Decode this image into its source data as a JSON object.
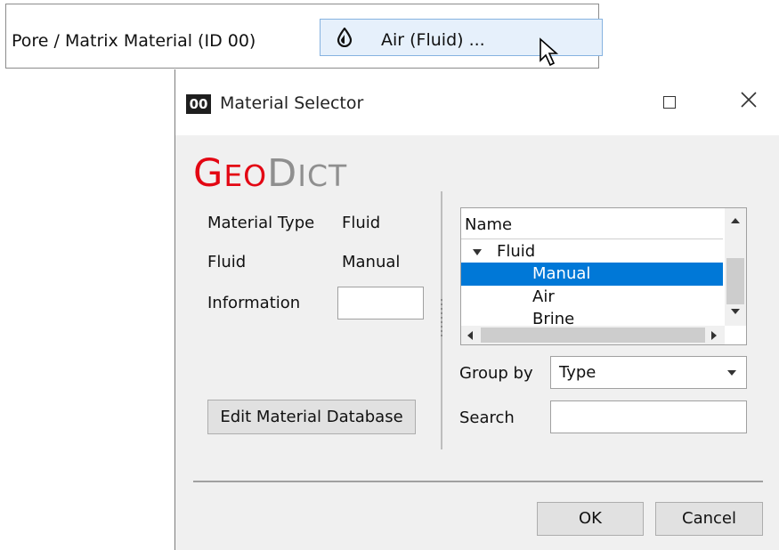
{
  "property": {
    "label": "Pore / Matrix Material (ID 00)",
    "value": "Air (Fluid) ..."
  },
  "window": {
    "icon_text": "00",
    "title": "Material Selector"
  },
  "logo": {
    "geo_big": "G",
    "geo_small": "EO",
    "dict_big": "D",
    "dict_small": "ICT"
  },
  "details": {
    "material_type_label": "Material Type",
    "material_type_value": "Fluid",
    "fluid_label": "Fluid",
    "fluid_value": "Manual",
    "information_label": "Information",
    "information_value": ""
  },
  "buttons": {
    "edit_db": "Edit Material Database",
    "ok": "OK",
    "cancel": "Cancel"
  },
  "tree": {
    "header": "Name",
    "group": "Fluid",
    "items": [
      "Manual",
      "Air",
      "Brine"
    ],
    "selected": "Manual"
  },
  "group_by": {
    "label": "Group by",
    "value": "Type"
  },
  "search": {
    "label": "Search",
    "value": ""
  },
  "colors": {
    "accent": "#0078d7",
    "logo_red": "#e30613",
    "logo_grey": "#8f8f8f"
  },
  "icons": [
    "drop-icon",
    "mouse-cursor-icon",
    "maximize-icon",
    "close-icon",
    "chevron-down-icon",
    "tree-expand-icon",
    "scroll-up-icon",
    "scroll-down-icon",
    "scroll-left-icon",
    "scroll-right-icon"
  ]
}
